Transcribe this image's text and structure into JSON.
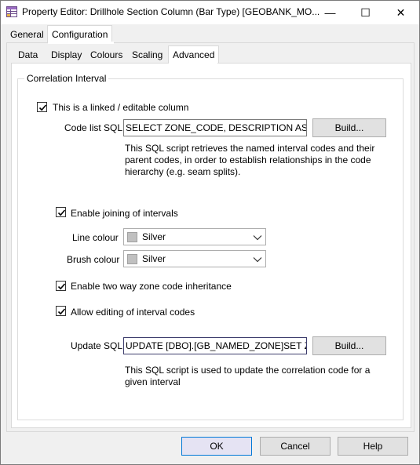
{
  "window": {
    "title": "Property Editor: Drillhole Section Column (Bar Type) [GEOBANK_MO...",
    "app_icon": "property-grid-icon",
    "controls": {
      "minimize": "—",
      "maximize": "☐",
      "close": "✕"
    }
  },
  "outer_tabs": [
    {
      "label": "General",
      "selected": false
    },
    {
      "label": "Configuration",
      "selected": true
    }
  ],
  "inner_tabs": [
    {
      "label": "Data",
      "selected": false
    },
    {
      "label": "Display",
      "selected": false
    },
    {
      "label": "Colours",
      "selected": false
    },
    {
      "label": "Scaling",
      "selected": false
    },
    {
      "label": "Advanced",
      "selected": true
    }
  ],
  "group": {
    "title": "Correlation Interval",
    "linked_checkbox": {
      "label": "This is a linked / editable column",
      "checked": true
    },
    "code_list_sql": {
      "label": "Code list SQL",
      "value": "SELECT  ZONE_CODE, DESCRIPTION AS DESCRIPTION",
      "button": "Build...",
      "description": "This SQL script retrieves the named interval codes and their parent codes, in order to establish relationships in the code hierarchy (e.g. seam splits)."
    },
    "enable_joining": {
      "label": "Enable joining of intervals",
      "checked": true
    },
    "line_colour": {
      "label": "Line colour",
      "value": "Silver",
      "color": "#c0c0c0"
    },
    "brush_colour": {
      "label": "Brush colour",
      "value": "Silver",
      "color": "#c0c0c0"
    },
    "two_way": {
      "label": "Enable two way zone code inheritance",
      "checked": true
    },
    "allow_editing": {
      "label": "Allow editing of interval codes",
      "checked": true
    },
    "update_sql": {
      "label": "Update SQL",
      "value": "UPDATE [DBO].[GB_NAMED_ZONE]SET  ZONE_CODE",
      "button": "Build...",
      "description": "This SQL script is used to update the correlation code for a given interval"
    }
  },
  "footer": {
    "ok": "OK",
    "cancel": "Cancel",
    "help": "Help"
  }
}
